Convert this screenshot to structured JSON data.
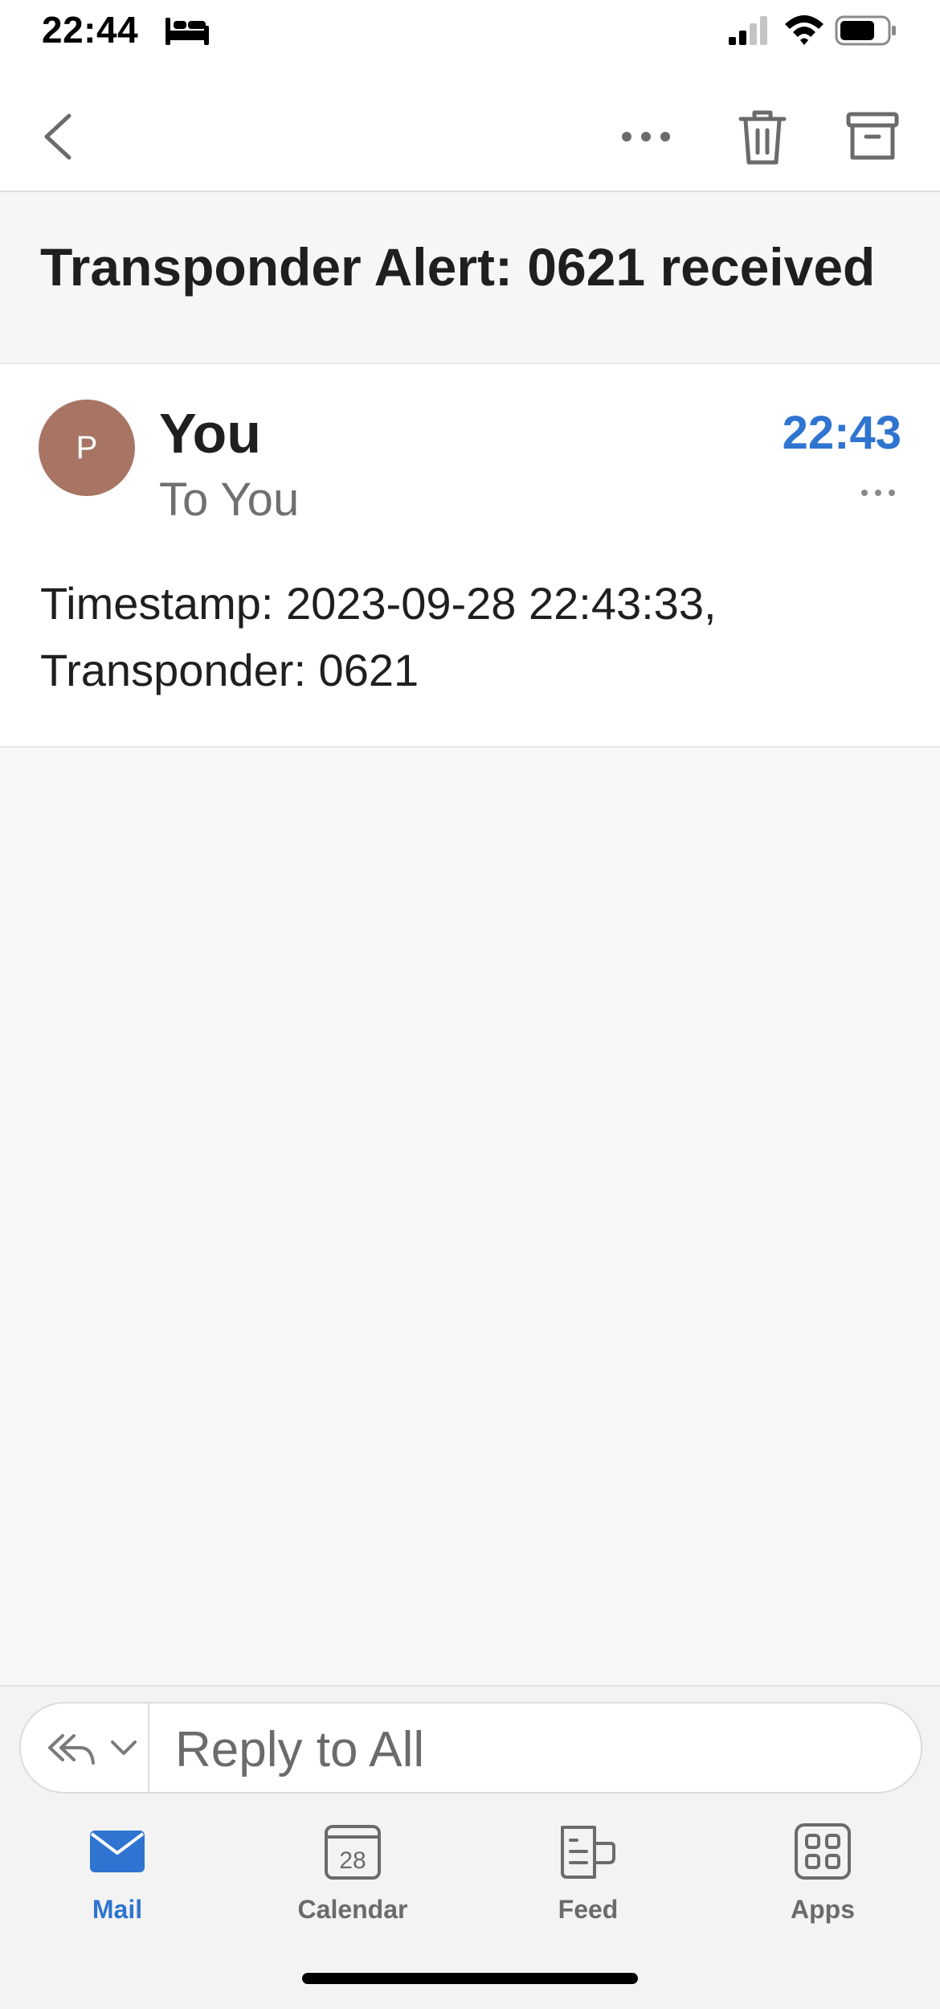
{
  "status_bar": {
    "time": "22:44"
  },
  "toolbar": {
    "icons": [
      "chevron-left-icon",
      "more-horizontal-icon",
      "trash-icon",
      "archive-icon"
    ]
  },
  "message": {
    "subject": "Transponder Alert: 0621 received",
    "avatar_initial": "P",
    "avatar_color": "#a87565",
    "sender": "You",
    "recipient": "To You",
    "time": "22:43",
    "body_line1": "Timestamp: 2023-09-28 22:43:33,",
    "body_line2": "Transponder: 0621"
  },
  "reply": {
    "placeholder": "Reply to All"
  },
  "tabs": [
    {
      "label": "Mail",
      "icon": "mail-icon",
      "active": true
    },
    {
      "label": "Calendar",
      "icon": "calendar-icon",
      "day": "28",
      "active": false
    },
    {
      "label": "Feed",
      "icon": "feed-icon",
      "active": false
    },
    {
      "label": "Apps",
      "icon": "apps-icon",
      "active": false
    }
  ],
  "colors": {
    "accent": "#2f74d0",
    "background": "#f7f7f7"
  }
}
